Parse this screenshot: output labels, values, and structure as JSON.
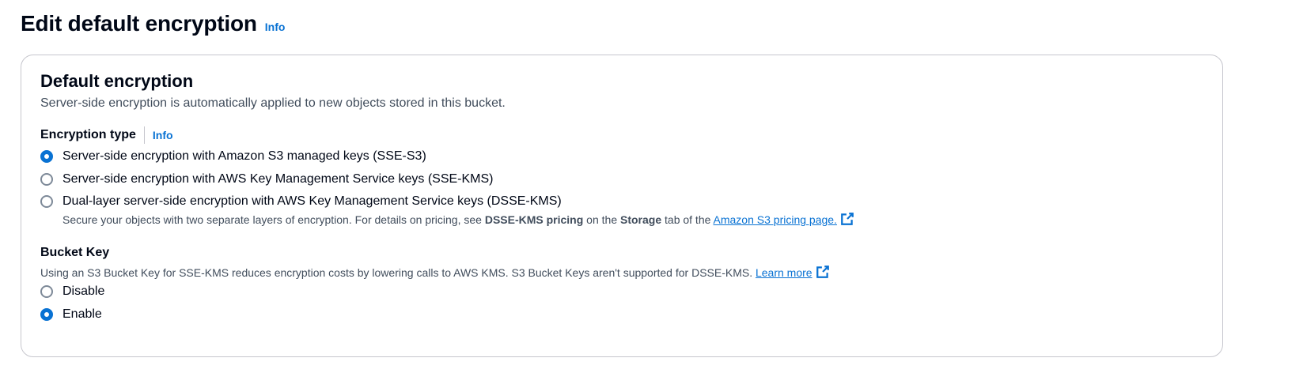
{
  "header": {
    "title": "Edit default encryption",
    "info_label": "Info"
  },
  "panel": {
    "title": "Default encryption",
    "description": "Server-side encryption is automatically applied to new objects stored in this bucket."
  },
  "encryption_type": {
    "label": "Encryption type",
    "info_label": "Info",
    "options": [
      {
        "label": "Server-side encryption with Amazon S3 managed keys (SSE-S3)",
        "selected": true
      },
      {
        "label": "Server-side encryption with AWS Key Management Service keys (SSE-KMS)",
        "selected": false
      },
      {
        "label": "Dual-layer server-side encryption with AWS Key Management Service keys (DSSE-KMS)",
        "selected": false
      }
    ],
    "dsse_desc": {
      "part1": "Secure your objects with two separate layers of encryption. For details on pricing, see ",
      "bold1": "DSSE-KMS pricing",
      "part2": " on the ",
      "bold2": "Storage",
      "part3": " tab of the ",
      "link": "Amazon S3 pricing page."
    }
  },
  "bucket_key": {
    "label": "Bucket Key",
    "help": "Using an S3 Bucket Key for SSE-KMS reduces encryption costs by lowering calls to AWS KMS. S3 Bucket Keys aren't supported for DSSE-KMS. ",
    "learn_more": "Learn more",
    "options": [
      {
        "label": "Disable",
        "selected": false
      },
      {
        "label": "Enable",
        "selected": true
      }
    ]
  },
  "colors": {
    "accent": "#0972d3",
    "text": "#000716",
    "secondary_text": "#414d5c",
    "border": "#c6c6cd"
  },
  "icons": {
    "external_link": "external-link-icon"
  }
}
